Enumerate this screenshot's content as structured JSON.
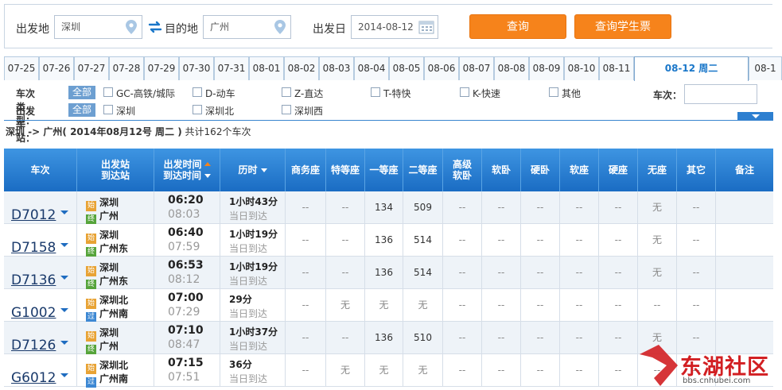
{
  "search": {
    "from_label": "出发地",
    "from_value": "深圳",
    "to_label": "目的地",
    "to_value": "广州",
    "date_label": "出发日",
    "date_value": "2014-08-12",
    "query_button": "查询",
    "student_button": "查询学生票"
  },
  "dates": [
    "07-25",
    "07-26",
    "07-27",
    "07-28",
    "07-29",
    "07-30",
    "07-31",
    "08-01",
    "08-02",
    "08-03",
    "08-04",
    "08-05",
    "08-06",
    "08-07",
    "08-08",
    "08-09",
    "08-10",
    "08-11",
    "08-12 周二",
    "08-1"
  ],
  "selected_date_index": 18,
  "filters": {
    "type_label": "车次类型：",
    "station_label": "出发车站：",
    "all_label": "全部",
    "types": [
      "GC-高铁/城际",
      "D-动车",
      "Z-直达",
      "T-特快",
      "K-快速",
      "其他"
    ],
    "stations": [
      "深圳",
      "深圳北",
      "深圳西"
    ],
    "train_no_label": "车次："
  },
  "summary": {
    "route": "深圳 -> 广州",
    "date": "( 2014年08月12号  周二 )",
    "count": "共计162个车次"
  },
  "table": {
    "headers": {
      "train": "车次",
      "station_from": "出发站",
      "station_to": "到达站",
      "time_dep": "出发时间",
      "time_arr": "到达时间",
      "duration": "历时",
      "seats": [
        "商务座",
        "特等座",
        "一等座",
        "二等座",
        "高级\n软卧",
        "软卧",
        "硬卧",
        "软座",
        "硬座",
        "无座",
        "其它"
      ],
      "remark": "备注"
    },
    "rows": [
      {
        "no": "D7012",
        "from": "深圳",
        "from_badge": "始",
        "to": "广州",
        "to_badge": "终",
        "dep": "06:20",
        "arr": "08:03",
        "dur": "1小时43分",
        "day": "当日到达",
        "seats": [
          "--",
          "--",
          "134",
          "509",
          "--",
          "--",
          "--",
          "--",
          "--",
          "无",
          "--"
        ]
      },
      {
        "no": "D7158",
        "from": "深圳",
        "from_badge": "始",
        "to": "广州东",
        "to_badge": "终",
        "dep": "06:40",
        "arr": "07:59",
        "dur": "1小时19分",
        "day": "当日到达",
        "seats": [
          "--",
          "--",
          "136",
          "514",
          "--",
          "--",
          "--",
          "--",
          "--",
          "无",
          "--"
        ]
      },
      {
        "no": "D7136",
        "from": "深圳",
        "from_badge": "始",
        "to": "广州东",
        "to_badge": "终",
        "dep": "06:53",
        "arr": "08:12",
        "dur": "1小时19分",
        "day": "当日到达",
        "seats": [
          "--",
          "--",
          "136",
          "514",
          "--",
          "--",
          "--",
          "--",
          "--",
          "无",
          "--"
        ]
      },
      {
        "no": "G1002",
        "from": "深圳北",
        "from_badge": "始",
        "to": "广州南",
        "to_badge": "过",
        "dep": "07:00",
        "arr": "07:29",
        "dur": "29分",
        "day": "当日到达",
        "seats": [
          "--",
          "无",
          "无",
          "无",
          "--",
          "--",
          "--",
          "--",
          "--",
          "--",
          "--"
        ]
      },
      {
        "no": "D7126",
        "from": "深圳",
        "from_badge": "始",
        "to": "广州",
        "to_badge": "终",
        "dep": "07:10",
        "arr": "08:47",
        "dur": "1小时37分",
        "day": "当日到达",
        "seats": [
          "--",
          "--",
          "136",
          "510",
          "--",
          "--",
          "--",
          "--",
          "--",
          "无",
          "--"
        ]
      },
      {
        "no": "G6012",
        "from": "深圳北",
        "from_badge": "始",
        "to": "广州南",
        "to_badge": "过",
        "dep": "07:15",
        "arr": "07:51",
        "dur": "36分",
        "day": "当日到达",
        "seats": [
          "--",
          "无",
          "无",
          "无",
          "--",
          "--",
          "--",
          "--",
          "--",
          "--",
          "--"
        ]
      }
    ]
  },
  "watermark": {
    "name": "东湖社区",
    "url": "bbs.cnhubei.com"
  },
  "colors": {
    "accent_orange": "#f6831b",
    "header_blue": "#1a6cc3",
    "link_blue": "#1a3a6b",
    "watermark_red": "#d21f22"
  }
}
